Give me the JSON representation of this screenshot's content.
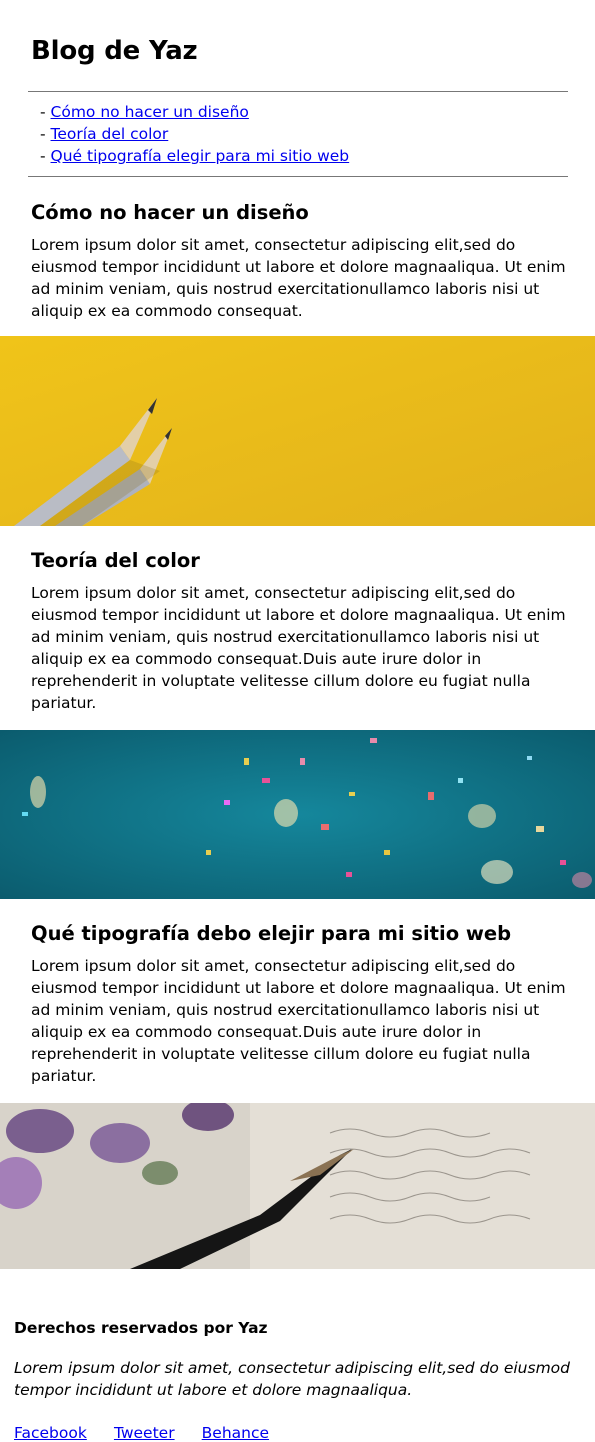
{
  "blog": {
    "title": "Blog de Yaz"
  },
  "toc": [
    {
      "dash": "-",
      "label": "Cómo no hacer un diseño"
    },
    {
      "dash": "-",
      "label": "Teoría del color"
    },
    {
      "dash": "-",
      "label": "Qué tipografía elegir para mi sitio web"
    }
  ],
  "posts": [
    {
      "title": "Cómo no hacer un diseño",
      "body": "Lorem ipsum dolor sit amet, consectetur adipiscing elit,sed do eiusmod tempor incididunt ut labore et dolore magnaaliqua. Ut enim ad minim veniam, quis nostrud exercitationullamco laboris nisi ut aliquip ex ea commodo consequat."
    },
    {
      "title": "Teoría del color",
      "body": "Lorem ipsum dolor sit amet, consectetur adipiscing elit,sed do eiusmod tempor incididunt ut labore et dolore magnaaliqua. Ut enim ad minim veniam, quis nostrud exercitationullamco laboris nisi ut aliquip ex ea commodo consequat.Duis aute irure dolor in reprehenderit in voluptate velitesse cillum dolore eu fugiat nulla pariatur."
    },
    {
      "title": "Qué tipografía debo elejir para mi sitio web",
      "body": "Lorem ipsum dolor sit amet, consectetur adipiscing elit,sed do eiusmod tempor incididunt ut labore et dolore magnaaliqua. Ut enim ad minim veniam, quis nostrud exercitationullamco laboris nisi ut aliquip ex ea commodo consequat.Duis aute irure dolor in reprehenderit in voluptate velitesse cillum dolore eu fugiat nulla pariatur."
    }
  ],
  "footer": {
    "rights": "Derechos reservados por Yaz",
    "note": "Lorem ipsum dolor sit amet, consectetur adipiscing elit,sed do eiusmod tempor incididunt ut labore et dolore magnaaliqua.",
    "links": [
      "Facebook",
      "Tweeter",
      "Behance"
    ]
  },
  "colors": {
    "link": "#0000ee",
    "yellow": "#ecbf1c",
    "teal": "#107a8e",
    "paper": "#d9d4cb"
  }
}
